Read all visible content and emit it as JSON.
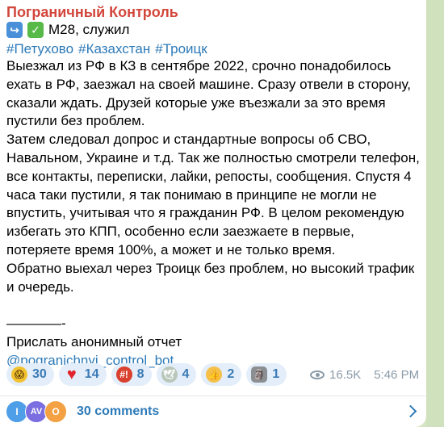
{
  "post": {
    "channel_name": "Пограничный Контроль",
    "meta_text": "M28, служил",
    "hashtags": [
      "#Петухово",
      "#Казахстан",
      "#Троицк"
    ],
    "paragraphs": [
      "Выезжал из РФ в КЗ в сентябре 2022, срочно понадобилось ехать в РФ, заезжал на своей машине. Сразу отвели в сторону, сказали ждать. Друзей которые уже въезжали за это время пустили без проблем.",
      "Затем следовал допрос и стандартные вопросы об СВО, Навальном, Украине и т.д. Так же полностью смотрели телефон, все контакты, переписки, лайки, репосты, сообщения. Спустя 4 часа таки пустили, я так понимаю в принципе не могли не впустить, учитывая что я гражданин РФ. В целом рекомендую избегать это КПП, особенно если заезжаете в первые, потеряете время 100%, а может и не только время.",
      "Обратно выехал через Троицк без проблем, но высокий трафик и очередь."
    ],
    "separator": "————-",
    "report_text": "Прислать анонимный отчет",
    "bot_link": "@pogranichnyi_control_bot"
  },
  "reactions": [
    {
      "icon": "screaming-face-icon",
      "count": "30"
    },
    {
      "icon": "heart-icon",
      "count": "14"
    },
    {
      "icon": "swearing-face-icon",
      "count": "8"
    },
    {
      "icon": "dove-icon",
      "count": "4"
    },
    {
      "icon": "thumbs-up-icon",
      "count": "2"
    },
    {
      "icon": "moai-icon",
      "count": "1"
    }
  ],
  "stats": {
    "views": "16.5K",
    "time": "5:46 PM"
  },
  "comments": {
    "avatars": [
      "I",
      "AV",
      "O"
    ],
    "label": "30 comments"
  },
  "colors": {
    "channel_name": "#d2463b",
    "link": "#2d7ab8",
    "reaction_bg": "#e3eefa"
  }
}
